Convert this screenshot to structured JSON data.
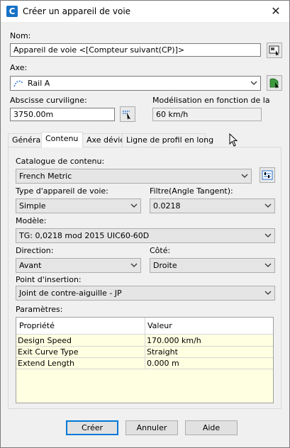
{
  "window": {
    "title": "Créer un appareil de voie",
    "close_label": "✕"
  },
  "name_section": {
    "label": "Nom:",
    "value": "Appareil de voie <[Compteur suivant(CP)]>"
  },
  "axis_section": {
    "label": "Axe:",
    "value": "Rail A"
  },
  "station_section": {
    "label": "Abscisse curviligne:",
    "value": "3750.00m"
  },
  "design_section": {
    "label": "Modélisation en fonction de la",
    "value": "60 km/h"
  },
  "tabs": [
    {
      "label": "Général",
      "active": false
    },
    {
      "label": "Contenu",
      "active": true
    },
    {
      "label": "Axe dévié",
      "active": false
    },
    {
      "label": "Ligne de profil en long",
      "active": false
    }
  ],
  "content": {
    "catalog_label": "Catalogue de contenu:",
    "catalog_value": "French Metric",
    "turnout_type_label": "Type d'appareil de voie:",
    "turnout_type_value": "Simple",
    "filter_label": "Filtre(Angle Tangent):",
    "filter_value": "0.0218",
    "model_label": "Modèle:",
    "model_value": "TG: 0,0218 mod 2015 UIC60-60D",
    "direction_label": "Direction:",
    "direction_value": "Avant",
    "side_label": "Côté:",
    "side_value": "Droite",
    "insertion_label": "Point d'insertion:",
    "insertion_value": "Joint de contre-aiguille - JP",
    "params_label": "Paramètres:",
    "params_columns": [
      "Propriété",
      "Valeur"
    ],
    "params_rows": [
      {
        "property": "Design Speed",
        "value": "170.000 km/h"
      },
      {
        "property": "Exit Curve Type",
        "value": "Straight"
      },
      {
        "property": "Extend Length",
        "value": "0.000 m"
      }
    ]
  },
  "buttons": {
    "create": "Créer",
    "cancel": "Annuler",
    "help": "Aide"
  },
  "colors": {
    "accent": "#0078d7",
    "app_icon": "#1672c6",
    "grid_bg": "#ffffe1",
    "pick_icon_green": "#3c9a3c"
  }
}
